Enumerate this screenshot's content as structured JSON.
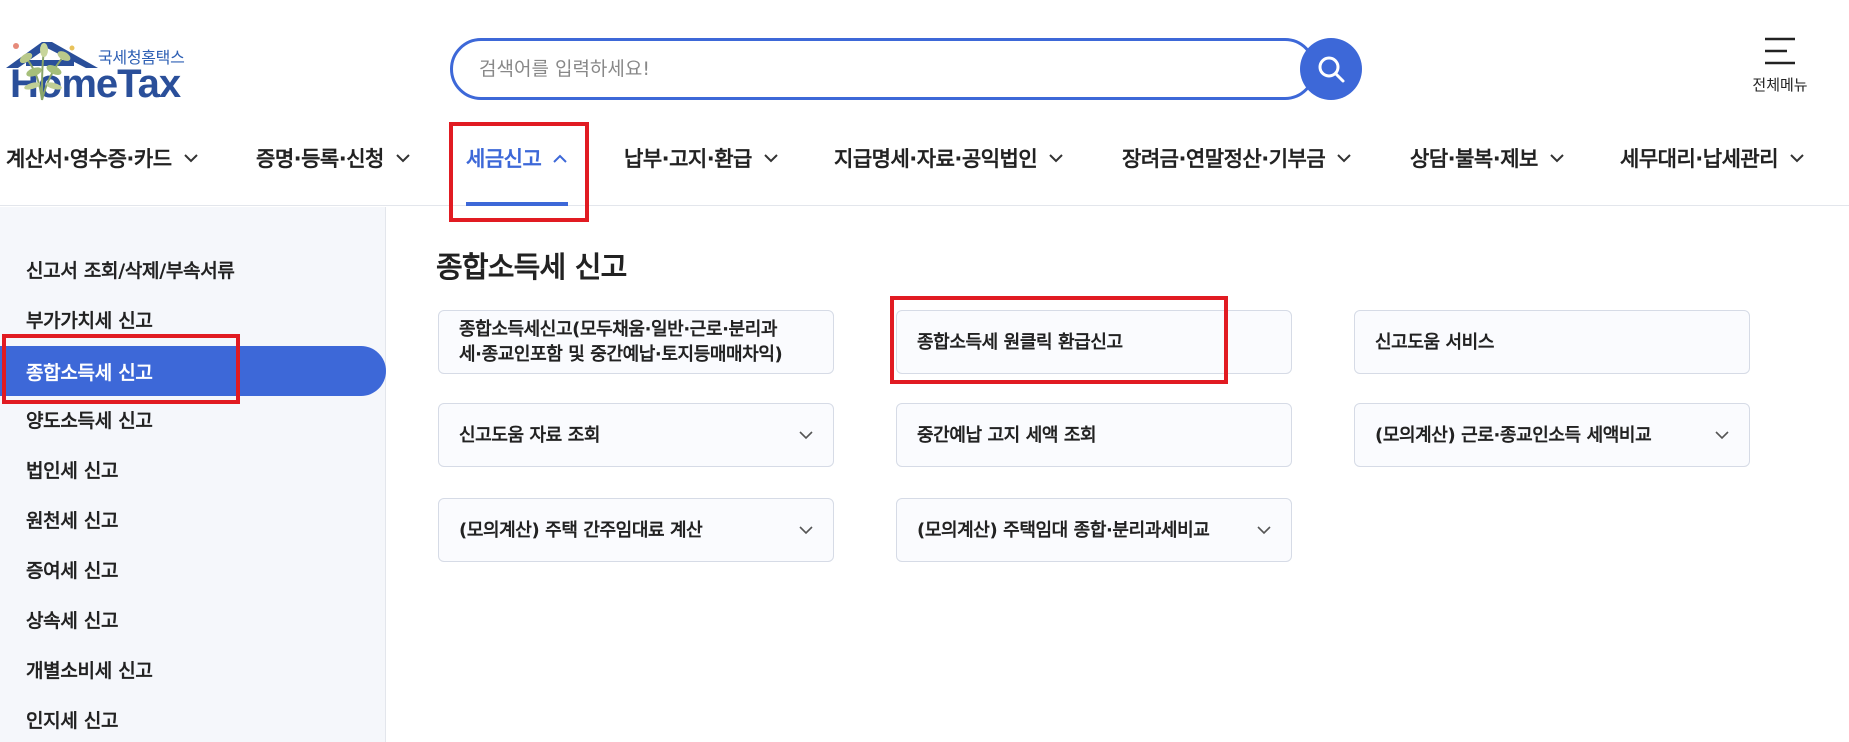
{
  "header": {
    "logo_sub": "국세청홈택스",
    "logo_main": "HomeTax",
    "search_placeholder": "검색어를 입력하세요!",
    "all_menu_label": "전체메뉴"
  },
  "gnb": {
    "items": [
      {
        "label": "계산서·영수증·카드"
      },
      {
        "label": "증명·등록·신청"
      },
      {
        "label": "세금신고",
        "active": true
      },
      {
        "label": "납부·고지·환급"
      },
      {
        "label": "지급명세·자료·공익법인"
      },
      {
        "label": "장려금·연말정산·기부금"
      },
      {
        "label": "상담·불복·제보"
      },
      {
        "label": "세무대리·납세관리"
      }
    ]
  },
  "sidebar": {
    "items": [
      {
        "label": "신고서 조회/삭제/부속서류"
      },
      {
        "label": "부가가치세 신고"
      },
      {
        "label": "종합소득세 신고",
        "active": true
      },
      {
        "label": "양도소득세 신고"
      },
      {
        "label": "법인세 신고"
      },
      {
        "label": "원천세 신고"
      },
      {
        "label": "증여세 신고"
      },
      {
        "label": "상속세 신고"
      },
      {
        "label": "개별소비세 신고"
      },
      {
        "label": "인지세 신고"
      }
    ]
  },
  "content": {
    "title": "종합소득세 신고",
    "cards": [
      {
        "label": "종합소득세신고(모두채움·일반·근로·분리과세·종교인포함 및 중간예납·토지등매매차익)",
        "line1": "종합소득세신고(모두채움·일반·근로·분리과",
        "line2": "세·종교인포함 및 중간예납·토지등매매차익)",
        "has_chevron": false
      },
      {
        "label": "종합소득세 원클릭 환급신고",
        "has_chevron": false
      },
      {
        "label": "신고도움 서비스",
        "has_chevron": false
      },
      {
        "label": "신고도움 자료 조회",
        "has_chevron": true
      },
      {
        "label": "중간예납 고지 세액 조회",
        "has_chevron": false
      },
      {
        "label": "(모의계산) 근로·종교인소득 세액비교",
        "has_chevron": true
      },
      {
        "label": "(모의계산) 주택 간주임대료 계산",
        "has_chevron": true
      },
      {
        "label": "(모의계산) 주택임대 종합·분리과세비교",
        "has_chevron": true
      }
    ]
  },
  "colors": {
    "accent": "#3d68d8",
    "highlight": "#e11b22",
    "sidebar_bg": "#f5f7fb",
    "card_border": "#d6dbe6"
  }
}
